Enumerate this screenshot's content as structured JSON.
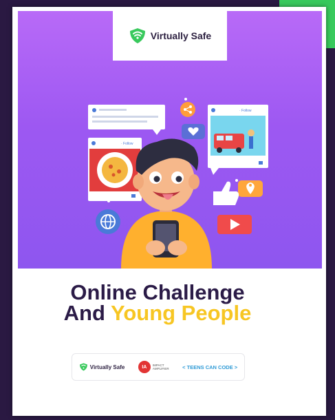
{
  "brand": {
    "name": "Virtually Safe"
  },
  "title": {
    "line1": "Online Challenge",
    "line2_start": "And ",
    "line2_accent": "Young People"
  },
  "hero": {
    "follow_label_left": "· Follow",
    "follow_label_right": "· Follow"
  },
  "sponsors": {
    "virtually_safe": "Virtually Safe",
    "impact_initials": "IA",
    "impact_line1": "IMPACT",
    "impact_line2": "AMPLIFIER",
    "teens_can_code": "< TEENS CAN CODE >"
  },
  "colors": {
    "hero_purple": "#9d58f2",
    "title_dark": "#2b1b47",
    "accent_yellow": "#f7c623",
    "brand_green": "#38c95c"
  }
}
